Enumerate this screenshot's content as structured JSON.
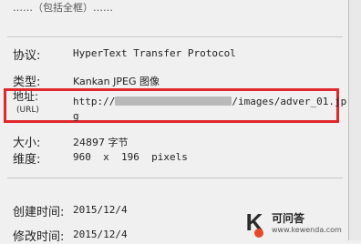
{
  "header": {
    "partial_title": "……（包括全框）……"
  },
  "properties": {
    "protocol": {
      "label": "协议:",
      "value": "HyperText Transfer Protocol"
    },
    "type": {
      "label": "类型:",
      "value": "Kankan JPEG 图像"
    },
    "address": {
      "label": "地址:",
      "sublabel": "(URL)",
      "prefix": "http://",
      "suffix": "/images/adver_01.jp",
      "wrap": "g"
    },
    "size": {
      "label": "大小:",
      "value": "24897 字节"
    },
    "dimensions": {
      "label": "维度:",
      "value": "960  x  196  pixels"
    },
    "created": {
      "label": "创建时间:",
      "value": "2015/12/4"
    },
    "modified": {
      "label": "修改时间:",
      "value": "2015/12/4"
    }
  },
  "watermark": {
    "logo_letter": "K",
    "title": "可问答",
    "site": "www.kewenda.com"
  }
}
